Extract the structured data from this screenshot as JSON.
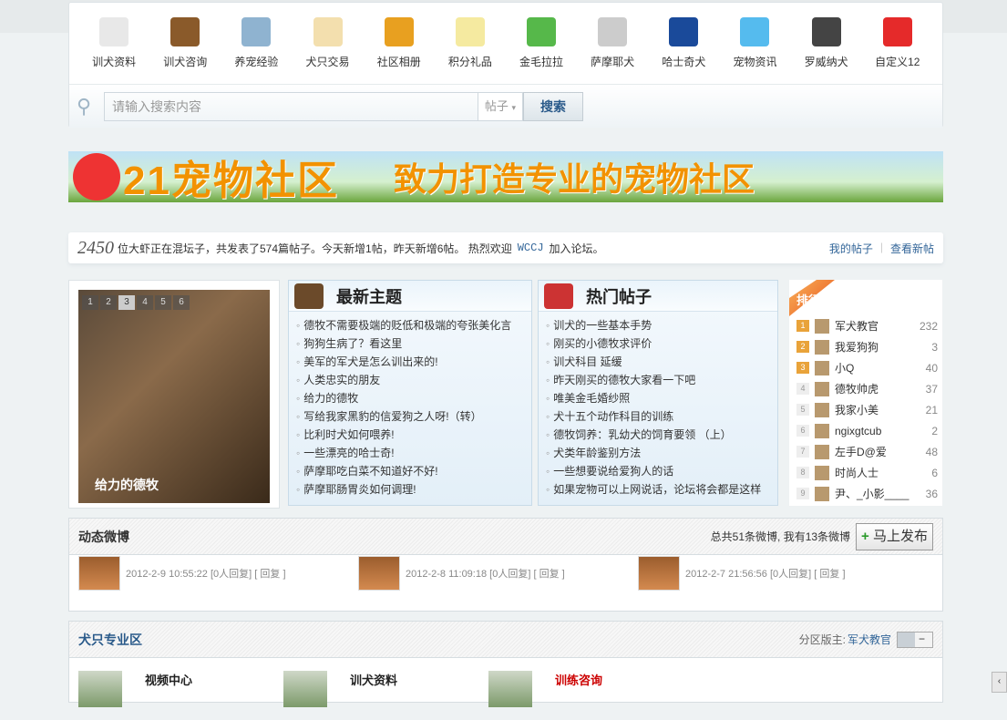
{
  "nav": {
    "items": [
      {
        "label": "训犬资料",
        "icon": "notepad-pin-icon",
        "color": "#e8e8e8"
      },
      {
        "label": "训犬咨询",
        "icon": "address-book-icon",
        "color": "#8a5a2a"
      },
      {
        "label": "养宠经验",
        "icon": "map-icon",
        "color": "#8fb3d0"
      },
      {
        "label": "犬只交易",
        "icon": "map-pin-icon",
        "color": "#f3dfae"
      },
      {
        "label": "社区相册",
        "icon": "photo-icon",
        "color": "#e8a020"
      },
      {
        "label": "积分礼品",
        "icon": "checklist-icon",
        "color": "#f5eaa0"
      },
      {
        "label": "金毛拉拉",
        "icon": "chat-bubbles-icon",
        "color": "#56b84a"
      },
      {
        "label": "萨摩耶犬",
        "icon": "cloud-icon",
        "color": "#cccccc"
      },
      {
        "label": "哈士奇犬",
        "icon": "book-icon",
        "color": "#1a4a9a"
      },
      {
        "label": "宠物资讯",
        "icon": "speech-bubble-icon",
        "color": "#55bbee"
      },
      {
        "label": "罗威纳犬",
        "icon": "gauge-icon",
        "color": "#444444"
      },
      {
        "label": "自定义12",
        "icon": "heart-icon",
        "color": "#e52a2a"
      }
    ]
  },
  "search": {
    "placeholder": "请输入搜索内容",
    "type": "帖子",
    "type_arrow": "▾",
    "button": "搜索"
  },
  "banner": {
    "title": "21宠物社区",
    "slogan": "致力打造专业的宠物社区"
  },
  "stats": {
    "online": "2450",
    "text1": "位大虾正在混坛子，共发表了574篇帖子。今天新增1帖，昨天新增6帖。 热烈欢迎",
    "new_user": "WCCJ",
    "text2": "加入论坛。",
    "my_posts": "我的帖子",
    "sep": "|",
    "new_posts": "查看新帖"
  },
  "slideshow": {
    "pages": [
      "1",
      "2",
      "3",
      "4",
      "5",
      "6"
    ],
    "active": "3",
    "caption": "给力的德牧"
  },
  "latest": {
    "title": "最新主题",
    "items": [
      "德牧不需要极端的贬低和极端的夸张美化言",
      "狗狗生病了？看这里",
      "美军的军犬是怎么训出来的!",
      "人类忠实的朋友",
      "给力的德牧",
      "写给我家黑豹的信爱狗之人呀!（转）",
      "比利时犬如何喂养!",
      "一些漂亮的哈士奇!",
      "萨摩耶吃白菜不知道好不好!",
      "萨摩耶肠胃炎如何调理!"
    ]
  },
  "hot": {
    "title": "热门帖子",
    "items": [
      "训犬的一些基本手势",
      "刚买的小德牧求评价",
      "训犬科目  延缓",
      "昨天刚买的德牧大家看一下吧",
      "唯美金毛婚纱照",
      "犬十五个动作科目的训练",
      "德牧饲养：乳幼犬的饲育要领 （上）",
      "犬类年龄鉴别方法",
      "一些想要说给爱狗人的话",
      "如果宠物可以上网说话，论坛将会都是这样"
    ]
  },
  "rank": {
    "title": "排行",
    "items": [
      {
        "n": "1",
        "name": "军犬教官",
        "count": "232"
      },
      {
        "n": "2",
        "name": "我爱狗狗",
        "count": "3"
      },
      {
        "n": "3",
        "name": "小Q",
        "count": "40"
      },
      {
        "n": "4",
        "name": "德牧帅虎",
        "count": "37"
      },
      {
        "n": "5",
        "name": "我家小美",
        "count": "21"
      },
      {
        "n": "6",
        "name": "ngixgtcub",
        "count": "2"
      },
      {
        "n": "7",
        "name": "左手D@爱",
        "count": "48"
      },
      {
        "n": "8",
        "name": "时尚人士",
        "count": "6"
      },
      {
        "n": "9",
        "name": "尹、_小影____",
        "count": "36"
      }
    ]
  },
  "weibo": {
    "title": "动态微博",
    "summary": "总共51条微博, 我有13条微博",
    "post_button": "马上发布",
    "post_icon": "+",
    "items": [
      {
        "time": "2012-2-9 10:55:22",
        "replies": "[0人回复]",
        "reply": "[ 回复 ]"
      },
      {
        "time": "2012-2-8 11:09:18",
        "replies": "[0人回复]",
        "reply": "[ 回复 ]"
      },
      {
        "time": "2012-2-7 21:56:56",
        "replies": "[0人回复]",
        "reply": "[ 回复 ]"
      }
    ]
  },
  "zone": {
    "title": "犬只专业区",
    "moderator_label": "分区版主:",
    "moderator": "军犬教官",
    "collapse": "−",
    "forums": [
      {
        "name": "视频中心",
        "color": "#222"
      },
      {
        "name": "训犬资料",
        "color": "#222"
      },
      {
        "name": "训练咨询",
        "color": "#cc0000"
      }
    ]
  }
}
